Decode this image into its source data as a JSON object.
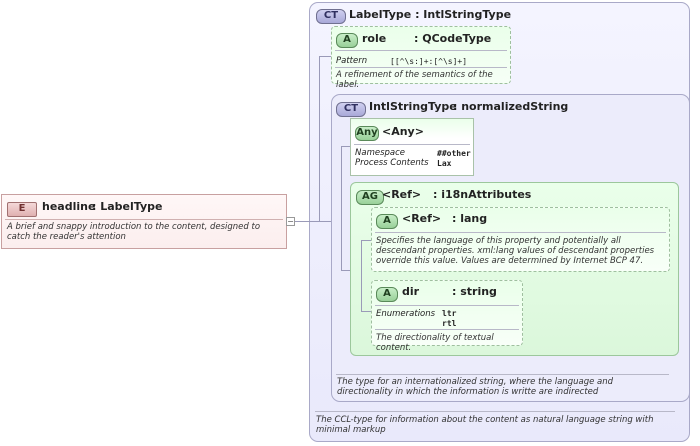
{
  "label_type": {
    "badge": "CT",
    "title": "LabelType : IntlStringType",
    "doc": "The CCL-type for information about the content as natural language string with minimal markup",
    "role_attr": {
      "badge": "A",
      "name": "role",
      "type": ": QCodeType",
      "pattern_label": "Pattern",
      "pattern_value": "[[^\\s:]+:[^\\s]+]",
      "doc": "A refinement of the semantics of the label."
    }
  },
  "intl_string_type": {
    "badge": "CT",
    "title": "IntlStringType",
    "base": ": normalizedString",
    "doc": "The type for an internationalized string, where the language and directionality in which the information is writte are indirected",
    "any": {
      "badge": "Any",
      "name": "<Any>",
      "ns_label": "Namespace",
      "ns_value": "##other",
      "pc_label": "Process Contents",
      "pc_value": "Lax"
    },
    "group": {
      "badge": "AG",
      "name": "<Ref>",
      "type": ": i18nAttributes",
      "lang": {
        "badge": "A",
        "name": "<Ref>",
        "type": ": lang",
        "doc": "Specifies the language of this property and potentially all descendant properties. xml:lang values of descendant properties override this value. Values are determined by Internet BCP 47."
      },
      "dir": {
        "badge": "A",
        "name": "dir",
        "type": ": string",
        "enum_label": "Enumerations",
        "enum_values": [
          "ltr",
          "rtl"
        ],
        "doc": "The directionality of textual content."
      }
    }
  },
  "headline": {
    "badge": "E",
    "name": "headline",
    "type": ": LabelType",
    "doc": "A brief and snappy introduction to the content, designed to catch the reader's attention"
  }
}
